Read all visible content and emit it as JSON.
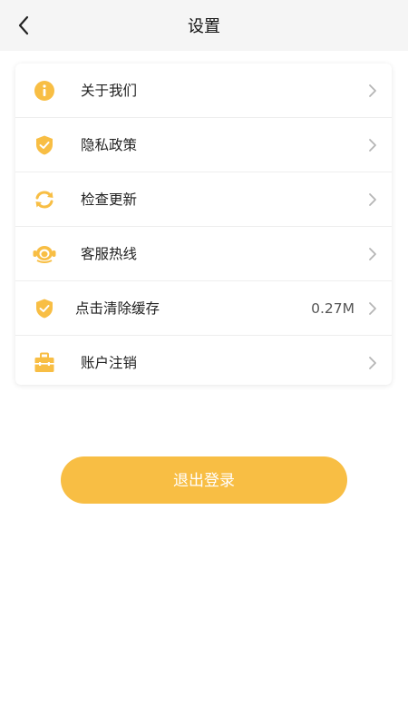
{
  "header": {
    "title": "设置",
    "back_icon": "back-arrow-icon"
  },
  "colors": {
    "accent": "#f8be44",
    "header_bg": "#f5f5f5",
    "text": "#222222",
    "chevron": "#b5b5b5"
  },
  "settings": {
    "items": [
      {
        "label": "关于我们",
        "icon": "info-icon",
        "value": ""
      },
      {
        "label": "隐私政策",
        "icon": "shield-icon",
        "value": ""
      },
      {
        "label": "检查更新",
        "icon": "refresh-icon",
        "value": ""
      },
      {
        "label": "客服热线",
        "icon": "headset-icon",
        "value": ""
      },
      {
        "label": "点击清除缓存",
        "icon": "shield-icon",
        "value": "0.27M"
      },
      {
        "label": "账户注销",
        "icon": "briefcase-icon",
        "value": ""
      }
    ]
  },
  "logout": {
    "label": "退出登录"
  }
}
